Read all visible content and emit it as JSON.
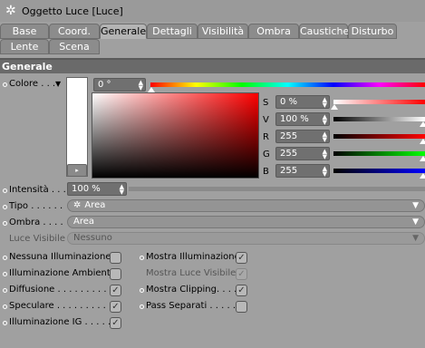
{
  "window": {
    "title": "Oggetto Luce [Luce]"
  },
  "tabs": [
    {
      "label": "Base"
    },
    {
      "label": "Coord."
    },
    {
      "label": "Generale"
    },
    {
      "label": "Dettagli"
    },
    {
      "label": "Visibilità"
    },
    {
      "label": "Ombra"
    },
    {
      "label": "Caustiche"
    },
    {
      "label": "Disturbo"
    },
    {
      "label": "Lente"
    },
    {
      "label": "Scena"
    }
  ],
  "active_tab": "Generale",
  "section": {
    "title": "Generale"
  },
  "color": {
    "label": "Colore . . .",
    "hue_value": "0 °",
    "s_label": "S",
    "s_value": "0 %",
    "v_label": "V",
    "v_value": "100 %",
    "r_label": "R",
    "r_value": "255",
    "g_label": "G",
    "g_value": "255",
    "b_label": "B",
    "b_value": "255"
  },
  "intensity": {
    "label": "Intensità . . .",
    "value": "100 %",
    "level": 1.0
  },
  "tipo": {
    "label": "Tipo . . . . . .",
    "value": "Area"
  },
  "ombra": {
    "label": "Ombra . . . .",
    "value": "Area"
  },
  "luce_visibile": {
    "label": "Luce Visibile",
    "value": "Nessuno"
  },
  "options_left": [
    {
      "label": "Nessuna Illuminazione",
      "checked": false
    },
    {
      "label": "Illuminazione Ambiente",
      "checked": false
    },
    {
      "label": "Diffusione . . . . . . . . . .",
      "checked": true
    },
    {
      "label": "Speculare . . . . . . . . . .",
      "checked": true
    },
    {
      "label": "Illuminazione IG . . . . .",
      "checked": true
    }
  ],
  "options_right": [
    {
      "label": "Mostra Illuminazione",
      "checked": true,
      "dim": false
    },
    {
      "label": "Mostra Luce Visibile",
      "checked": true,
      "dim": true
    },
    {
      "label": "Mostra Clipping. . . . .",
      "checked": true,
      "dim": false
    },
    {
      "label": "Pass Separati . . . . . .",
      "checked": false,
      "dim": false
    }
  ],
  "colors": {
    "accent": "#ff0000",
    "panel": "#a0a0a0",
    "field": "#707070"
  }
}
